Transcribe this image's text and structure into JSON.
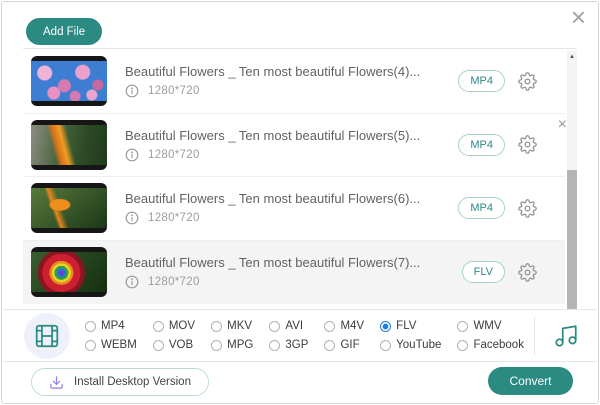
{
  "icons": {
    "close": "×",
    "row_close": "×",
    "scroll_up": "▲"
  },
  "toolbar": {
    "add_file_label": "Add File"
  },
  "file_list": {
    "items": [
      {
        "title": "Beautiful Flowers _ Ten most beautiful Flowers(4)...",
        "resolution": "1280*720",
        "format": "MP4",
        "thumbnail": "pink-blossoms",
        "selected": false,
        "removable": false
      },
      {
        "title": "Beautiful Flowers _ Ten most beautiful Flowers(5)...",
        "resolution": "1280*720",
        "format": "MP4",
        "thumbnail": "bird-of-paradise-wide",
        "selected": false,
        "removable": true
      },
      {
        "title": "Beautiful Flowers _ Ten most beautiful Flowers(6)...",
        "resolution": "1280*720",
        "format": "MP4",
        "thumbnail": "bird-of-paradise-closeup",
        "selected": false,
        "removable": false
      },
      {
        "title": "Beautiful Flowers _ Ten most beautiful Flowers(7)...",
        "resolution": "1280*720",
        "format": "FLV",
        "thumbnail": "rainbow-rose",
        "selected": true,
        "removable": false
      }
    ]
  },
  "format_bar": {
    "options": [
      "MP4",
      "MOV",
      "MKV",
      "AVI",
      "M4V",
      "FLV",
      "WMV",
      "WEBM",
      "VOB",
      "MPG",
      "3GP",
      "GIF",
      "YouTube",
      "Facebook"
    ],
    "selected": "FLV"
  },
  "footer": {
    "install_label": "Install Desktop Version",
    "convert_label": "Convert"
  },
  "colors": {
    "accent_teal": "#2b8a82",
    "selected_radio_blue": "#1d7fe0",
    "row_highlight": "#f4f4f4",
    "badge_border": "#a6d2cc"
  }
}
